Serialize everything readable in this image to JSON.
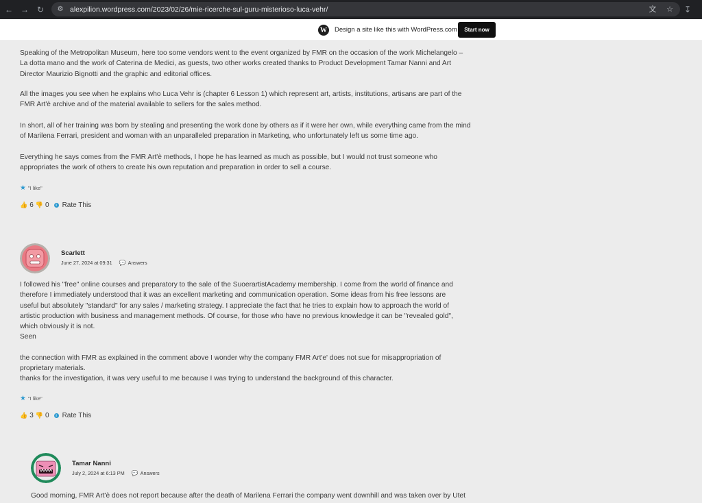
{
  "browser": {
    "url": "alexpilion.wordpress.com/2023/02/26/mie-ricerche-sul-guru-misterioso-luca-vehr/"
  },
  "wp_banner": {
    "text": "Design a site like this with WordPress.com",
    "button": "Start now"
  },
  "post": {
    "paragraphs": [
      "Speaking of the Metropolitan Museum, here too some vendors went to the event organized by FMR on the occasion of the work Michelangelo – La dotta mano and the work of Caterina de Medici, as guests, two other works created thanks to Product Development Tamar Nanni and Art Director Maurizio Bignotti and the graphic and editorial offices.",
      "All the images you see when he explains who Luca Vehr is (chapter 6 Lesson 1) which represent art, artists, institutions, artisans are part of the FMR Art'è archive and of the material available to sellers for the sales method.",
      "In short, all of her training was born by stealing and presenting the work done by others as if it were her own, while everything came from the mind of Marilena Ferrari, president and woman with an unparalleled preparation in Marketing, who unfortunately left us some time ago.",
      "Everything he says comes from the FMR Art'è methods, I hope he has learned as much as possible, but I would not trust someone who appropriates the work of others to create his own reputation and preparation in order to sell a course."
    ],
    "like_label": "\"I like\"",
    "up_count": "6",
    "down_count": "0",
    "rate_label": "Rate This"
  },
  "comments": [
    {
      "author": "Scarlett",
      "date": "June 27, 2024 at 09:31",
      "answers": "Answers",
      "paragraphs": [
        "I followed his \"free\" online courses and preparatory to the sale of the SuoerartistAcademy membership. I come from the world of finance and therefore I immediately understood that it was an excellent marketing and communication operation. Some ideas from his free lessons are useful but absolutely \"standard\" for any sales / marketing strategy. I appreciate the fact that he tries to explain how to approach the world of artistic production with business and management methods. Of course, for those who have no previous knowledge it can be \"revealed gold\", which obviously it is not.",
        "Seen",
        "the connection with FMR as explained in the comment above I wonder why the company FMR Art'e' does not sue for misappropriation of proprietary materials.",
        "thanks for the investigation, it was very useful to me because I was trying to understand the background of this character."
      ],
      "like_label": "\"I like\"",
      "up_count": "3",
      "down_count": "0",
      "rate_label": "Rate This"
    },
    {
      "author": "Tamar Nanni",
      "date": "July 2, 2024 at 6:13 PM",
      "answers": "Answers",
      "paragraphs": [
        "Good morning, FMR Art'è does not report because after the death of Marilena Ferrari the company went downhill and was taken over by Utet"
      ]
    }
  ],
  "colors": {
    "page_bg": "#ececec",
    "accent": "#2e9ad0"
  }
}
